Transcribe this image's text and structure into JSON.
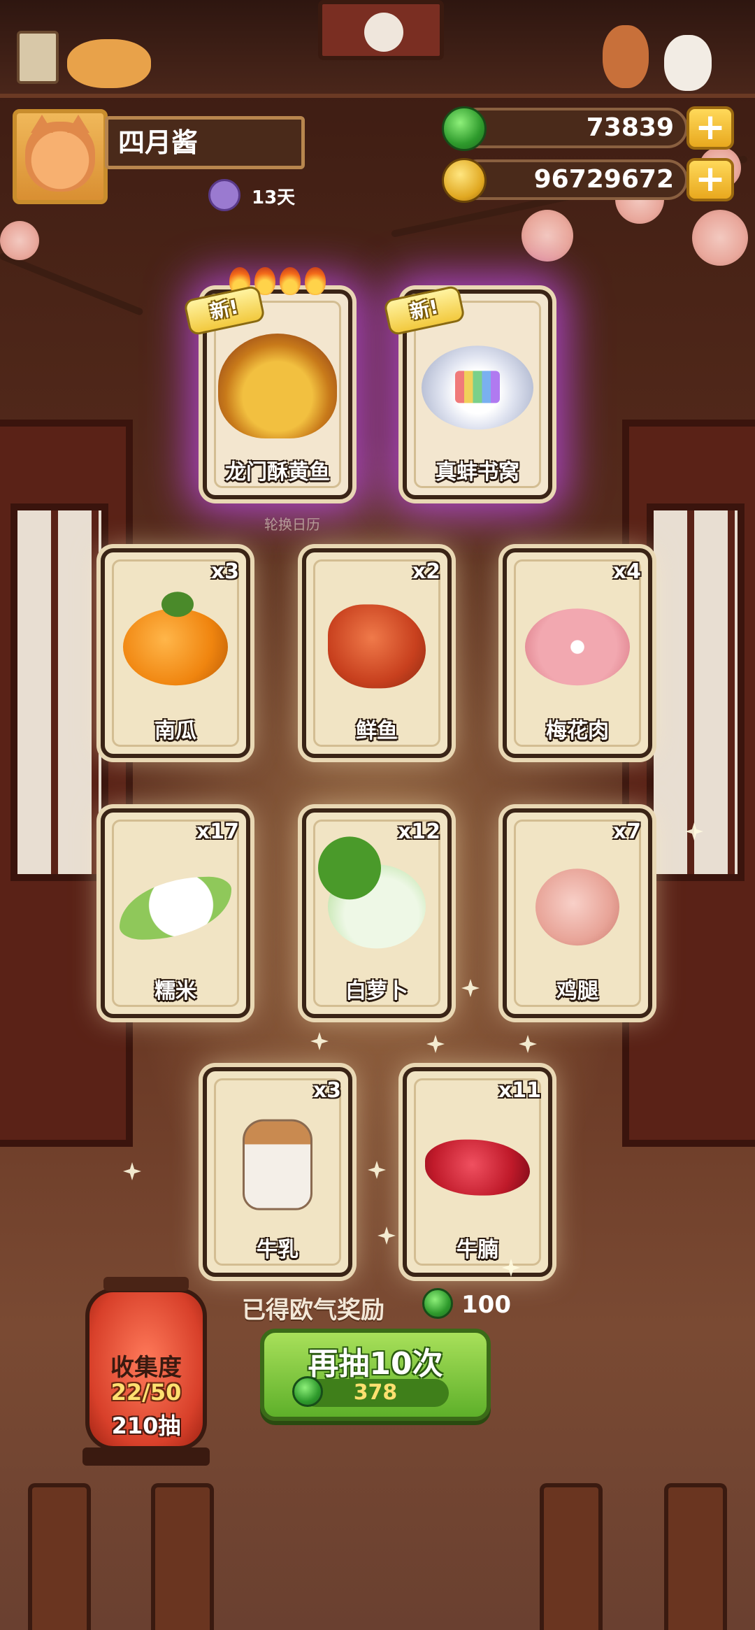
{
  "player": {
    "name": "四月酱",
    "days": "13天"
  },
  "currency": {
    "jade": "73839",
    "coins": "96729672"
  },
  "rotate_calendar": "轮换日历",
  "new_badge": "新!",
  "featured_cards": [
    {
      "name": "龙门酥黄鱼",
      "new": true,
      "flames": 4,
      "rarity": "purple"
    },
    {
      "name": "真蚌书窝",
      "new": true,
      "rarity": "purple"
    }
  ],
  "cards": [
    {
      "name": "南瓜",
      "count": "x3"
    },
    {
      "name": "鲜鱼",
      "count": "x2"
    },
    {
      "name": "梅花肉",
      "count": "x4"
    },
    {
      "name": "糯米",
      "count": "x17"
    },
    {
      "name": "白萝卜",
      "count": "x12"
    },
    {
      "name": "鸡腿",
      "count": "x7"
    },
    {
      "name": "牛乳",
      "count": "x3"
    },
    {
      "name": "牛腩",
      "count": "x11"
    }
  ],
  "reward": {
    "label": "已得欧气奖励",
    "value": "100"
  },
  "draw_button": {
    "label": "再抽10次",
    "cost": "378"
  },
  "collection": {
    "title": "收集度",
    "progress": "22/50",
    "draws": "210抽"
  },
  "colors": {
    "jade": "#2e9a2c",
    "coin": "#e0a720",
    "purple_glow": "#c850ff",
    "button_green": "#5eb02a"
  }
}
